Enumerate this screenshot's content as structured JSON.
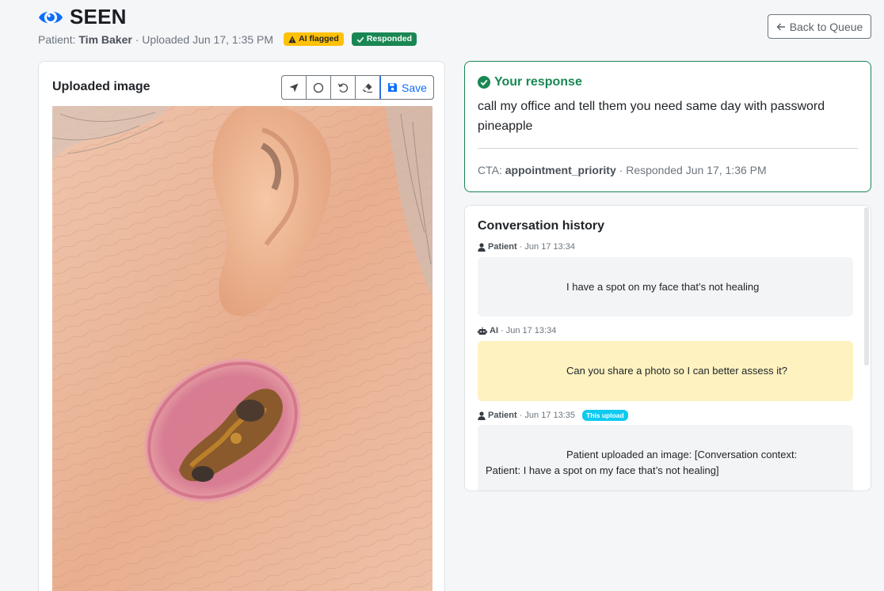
{
  "header": {
    "title": "SEEN",
    "patient_label": "Patient:",
    "patient_name": "Tim Baker",
    "uploaded": "· Uploaded Jun 17, 1:35 PM",
    "badge_flagged": "AI flagged",
    "badge_responded": "Responded",
    "back_button": "Back to Queue"
  },
  "image_card": {
    "title": "Uploaded image",
    "save_label": "Save",
    "tools": [
      "arrow-tool-icon",
      "circle-tool-icon",
      "undo-icon",
      "eraser-icon"
    ]
  },
  "response": {
    "title": "Your response",
    "text": "call my office and tell them you need same day with password pineapple",
    "cta_label": "CTA:",
    "cta_value": "appointment_priority",
    "responded": "· Responded Jun 17, 1:36 PM"
  },
  "conversation": {
    "title": "Conversation history",
    "messages": [
      {
        "sender": "Patient",
        "time": "· Jun 17 13:34",
        "text": "I have a spot on my face that’s not healing"
      },
      {
        "sender": "AI",
        "time": "· Jun 17 13:34",
        "text": "Can you share a photo so I can better assess it?"
      },
      {
        "sender": "Patient",
        "time": "· Jun 17 13:35",
        "tag": "This upload",
        "text": "Patient uploaded an image: [Conversation context:",
        "text2": "Patient: I have a spot on my face that’s not healing]"
      }
    ]
  },
  "colors": {
    "brand": "#0d6efd",
    "success": "#198754",
    "warning": "#ffc107",
    "info": "#0dcaf0",
    "ai_bubble": "#fdf2c0"
  }
}
